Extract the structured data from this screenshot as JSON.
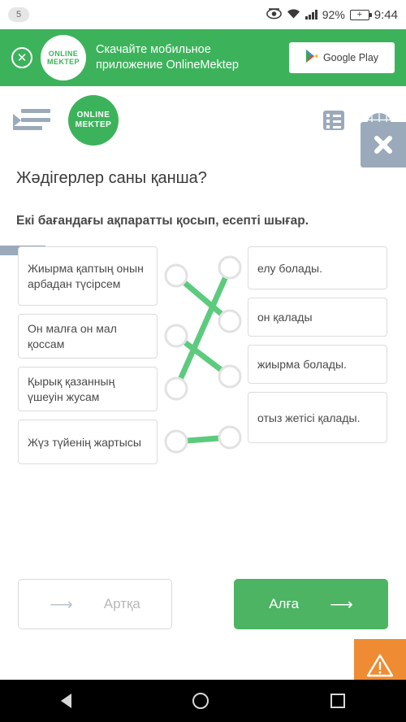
{
  "theme": {
    "brand_green": "#3cb35b",
    "button_green": "#4cb462",
    "link_green": "#5ccb7e",
    "grey_ui": "#9aaabb",
    "warn_orange": "#ef8b33"
  },
  "statusbar": {
    "badge": "5",
    "eye_icon": "eye-icon",
    "wifi_icon": "wifi-icon",
    "signal_icon": "signal-bars-icon",
    "battery_percent": "92%",
    "battery_icon": "battery-charging-icon",
    "battery_glyph": "+",
    "clock": "9:44"
  },
  "promo": {
    "close_icon": "close-icon",
    "logo_line1": "ONLINE",
    "logo_line2": "MEKTEP",
    "text_line1": "Скачайте мобильное",
    "text_line2": "приложение OnlineMektep",
    "store_button_label": "Google Play",
    "store_icon": "google-play-icon"
  },
  "appbar": {
    "menu_icon": "menu-indent-icon",
    "logo_line1": "ONLINE",
    "logo_line2": "MEKTEP",
    "list_icon": "list-icon",
    "globe_icon": "globe-icon",
    "panel_close_icon": "close-icon"
  },
  "question": {
    "title": "Жәдігерлер саны қанша?",
    "instruction": "Екі бағандағы ақпаратты қосып, есепті шығар."
  },
  "matching": {
    "left_options": [
      "Жиырма қаптың онын арбадан түсірсем",
      "Он малға он мал қоссам",
      "Қырық қазанның үшеуін жусам",
      "Жүз түйенің жартысы"
    ],
    "right_options": [
      "елу болады.",
      "он қалады",
      "жиырма болады.",
      "отыз жетісі қалады."
    ],
    "connections": [
      {
        "left_index": 0,
        "right_index": 1
      },
      {
        "left_index": 1,
        "right_index": 2
      },
      {
        "left_index": 2,
        "right_index": 0
      },
      {
        "left_index": 3,
        "right_index": 3
      }
    ]
  },
  "footer": {
    "back_label": "Артқа",
    "back_icon": "arrow-left-icon",
    "next_label": "Алға",
    "next_icon": "arrow-right-icon",
    "warning_icon": "warning-triangle-icon"
  },
  "navbar": {
    "back_icon": "android-back-icon",
    "home_icon": "android-home-icon",
    "recents_icon": "android-recents-icon"
  }
}
